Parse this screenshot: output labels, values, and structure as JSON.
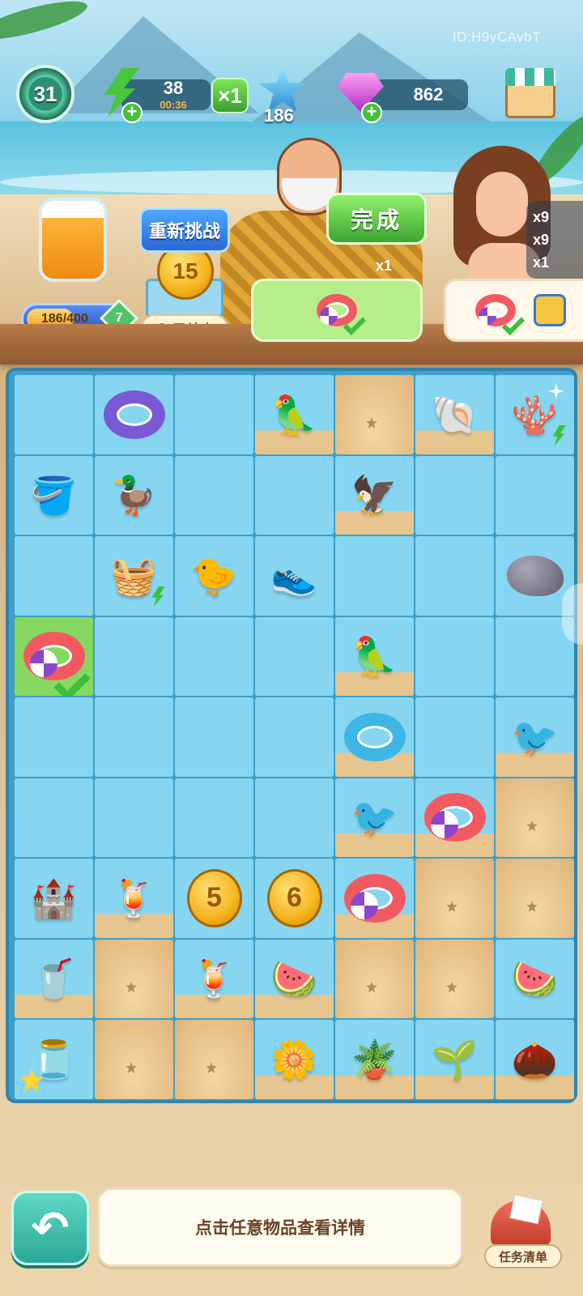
{
  "hud": {
    "player_id": "ID:H9yCAvbT",
    "level": "31",
    "energy": "38",
    "energy_timer": "00:36",
    "multiplier": "×1",
    "stars": "186",
    "gems": "862"
  },
  "event": {
    "challenge_button": "重新挑战",
    "coin_value": "15",
    "ended_label": "已结束",
    "jar_progress_text": "186/400",
    "jar_progress_fraction": 0.465,
    "jar_level": "7"
  },
  "order": {
    "complete_button": "完成",
    "reward_count": "x1",
    "side_rewards": [
      "x9",
      "x9",
      "x1"
    ]
  },
  "board": {
    "rows": [
      [
        {
          "bg": "blue",
          "item": ""
        },
        {
          "bg": "blue",
          "item": "lifebuoy-purple"
        },
        {
          "bg": "blue",
          "item": ""
        },
        {
          "bg": "partsand",
          "item": "cockatoo"
        },
        {
          "bg": "sand",
          "item": ""
        },
        {
          "bg": "partsand",
          "item": "conch-shell"
        },
        {
          "bg": "blue",
          "item": "coral-shell"
        }
      ],
      [
        {
          "bg": "blue",
          "item": "sand-bucket"
        },
        {
          "bg": "blue",
          "item": "duck-float"
        },
        {
          "bg": "blue",
          "item": ""
        },
        {
          "bg": "blue",
          "item": ""
        },
        {
          "bg": "partsand",
          "item": "vulture"
        },
        {
          "bg": "blue",
          "item": ""
        },
        {
          "bg": "blue",
          "item": ""
        }
      ],
      [
        {
          "bg": "blue",
          "item": ""
        },
        {
          "bg": "blue",
          "item": "picnic-basket"
        },
        {
          "bg": "blue",
          "item": "rubber-duck"
        },
        {
          "bg": "blue",
          "item": "shoe-box"
        },
        {
          "bg": "blue",
          "item": ""
        },
        {
          "bg": "blue",
          "item": ""
        },
        {
          "bg": "blue",
          "item": "rock"
        }
      ],
      [
        {
          "bg": "selected",
          "item": "lifebuoy-ball"
        },
        {
          "bg": "blue",
          "item": ""
        },
        {
          "bg": "blue",
          "item": ""
        },
        {
          "bg": "blue",
          "item": ""
        },
        {
          "bg": "partsand",
          "item": "parrot"
        },
        {
          "bg": "blue",
          "item": ""
        },
        {
          "bg": "blue",
          "item": ""
        }
      ],
      [
        {
          "bg": "blue",
          "item": ""
        },
        {
          "bg": "blue",
          "item": ""
        },
        {
          "bg": "blue",
          "item": ""
        },
        {
          "bg": "blue",
          "item": ""
        },
        {
          "bg": "partsand",
          "item": "donut-float"
        },
        {
          "bg": "blue",
          "item": ""
        },
        {
          "bg": "partsand",
          "item": "blue-bird"
        }
      ],
      [
        {
          "bg": "blue",
          "item": ""
        },
        {
          "bg": "blue",
          "item": ""
        },
        {
          "bg": "blue",
          "item": ""
        },
        {
          "bg": "blue",
          "item": ""
        },
        {
          "bg": "partsand",
          "item": "blue-bird"
        },
        {
          "bg": "partsand",
          "item": "lifebuoy-ball"
        },
        {
          "bg": "sand",
          "item": ""
        }
      ],
      [
        {
          "bg": "blue",
          "item": "sandcastle"
        },
        {
          "bg": "partsand",
          "item": "watermelon-drinks"
        },
        {
          "bg": "blue",
          "item": "coin",
          "label": "5"
        },
        {
          "bg": "blue",
          "item": "coin",
          "label": "6"
        },
        {
          "bg": "partsand",
          "item": "lifebuoy-ball"
        },
        {
          "bg": "sand",
          "item": ""
        },
        {
          "bg": "sand",
          "item": ""
        }
      ],
      [
        {
          "bg": "partsand",
          "item": "smoothie"
        },
        {
          "bg": "sand",
          "item": ""
        },
        {
          "bg": "partsand",
          "item": "juice-pitcher"
        },
        {
          "bg": "partsand",
          "item": "watermelon"
        },
        {
          "bg": "sand",
          "item": ""
        },
        {
          "bg": "sand",
          "item": ""
        },
        {
          "bg": "blue",
          "item": "watermelon-plate"
        }
      ],
      [
        {
          "bg": "blue",
          "item": "juicer"
        },
        {
          "bg": "sand",
          "item": ""
        },
        {
          "bg": "sand",
          "item": ""
        },
        {
          "bg": "partsand",
          "item": "flower-pot"
        },
        {
          "bg": "partsand",
          "item": "potted-plant"
        },
        {
          "bg": "partsand",
          "item": "sprout"
        },
        {
          "bg": "partsand",
          "item": "seed"
        }
      ]
    ]
  },
  "footer": {
    "hint": "点击任意物品查看详情",
    "task_list_label": "任务清单"
  },
  "colors": {
    "accent_green": "#3ea62f",
    "accent_blue": "#2969d8",
    "tile_blue": "#86d6f2",
    "tile_sand": "#ddb57a"
  }
}
